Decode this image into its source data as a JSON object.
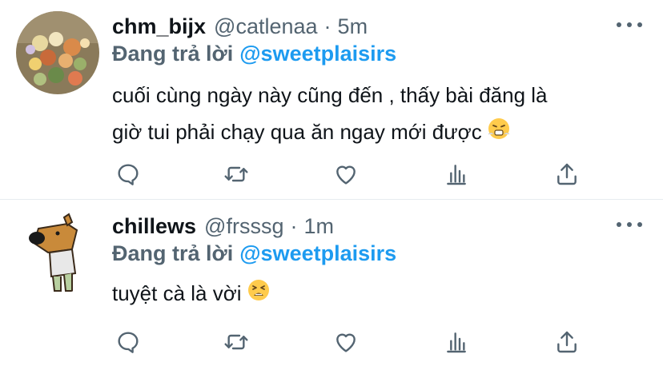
{
  "colors": {
    "text": "#0f1419",
    "secondary": "#536471",
    "link": "#1d9bf0",
    "divider": "#e6ecf0"
  },
  "tweets": [
    {
      "name": "chm_bijx",
      "handle": "@catlenaa",
      "separator": "·",
      "time": "5m",
      "reply_prefix": "Đang trả lời",
      "reply_to": "@sweetplaisirs",
      "text_line1": "cuối cùng ngày này cũng đến , thấy bài đăng là",
      "text_line2": "giờ tui phải chạy qua ăn ngay mới được",
      "emoji": "face-with-steam-from-nose",
      "avatar": "flower-bouquet-photo"
    },
    {
      "name": "chillews",
      "handle": "@frsssg",
      "separator": "·",
      "time": "1m",
      "reply_prefix": "Đang trả lời",
      "reply_to": "@sweetplaisirs",
      "text_line1": "tuyệt cà là vời",
      "emoji": "tired-face",
      "avatar": "cartoon-dog-character"
    }
  ],
  "actions": [
    "reply-icon",
    "retweet-icon",
    "like-icon",
    "analytics-icon",
    "share-icon"
  ]
}
